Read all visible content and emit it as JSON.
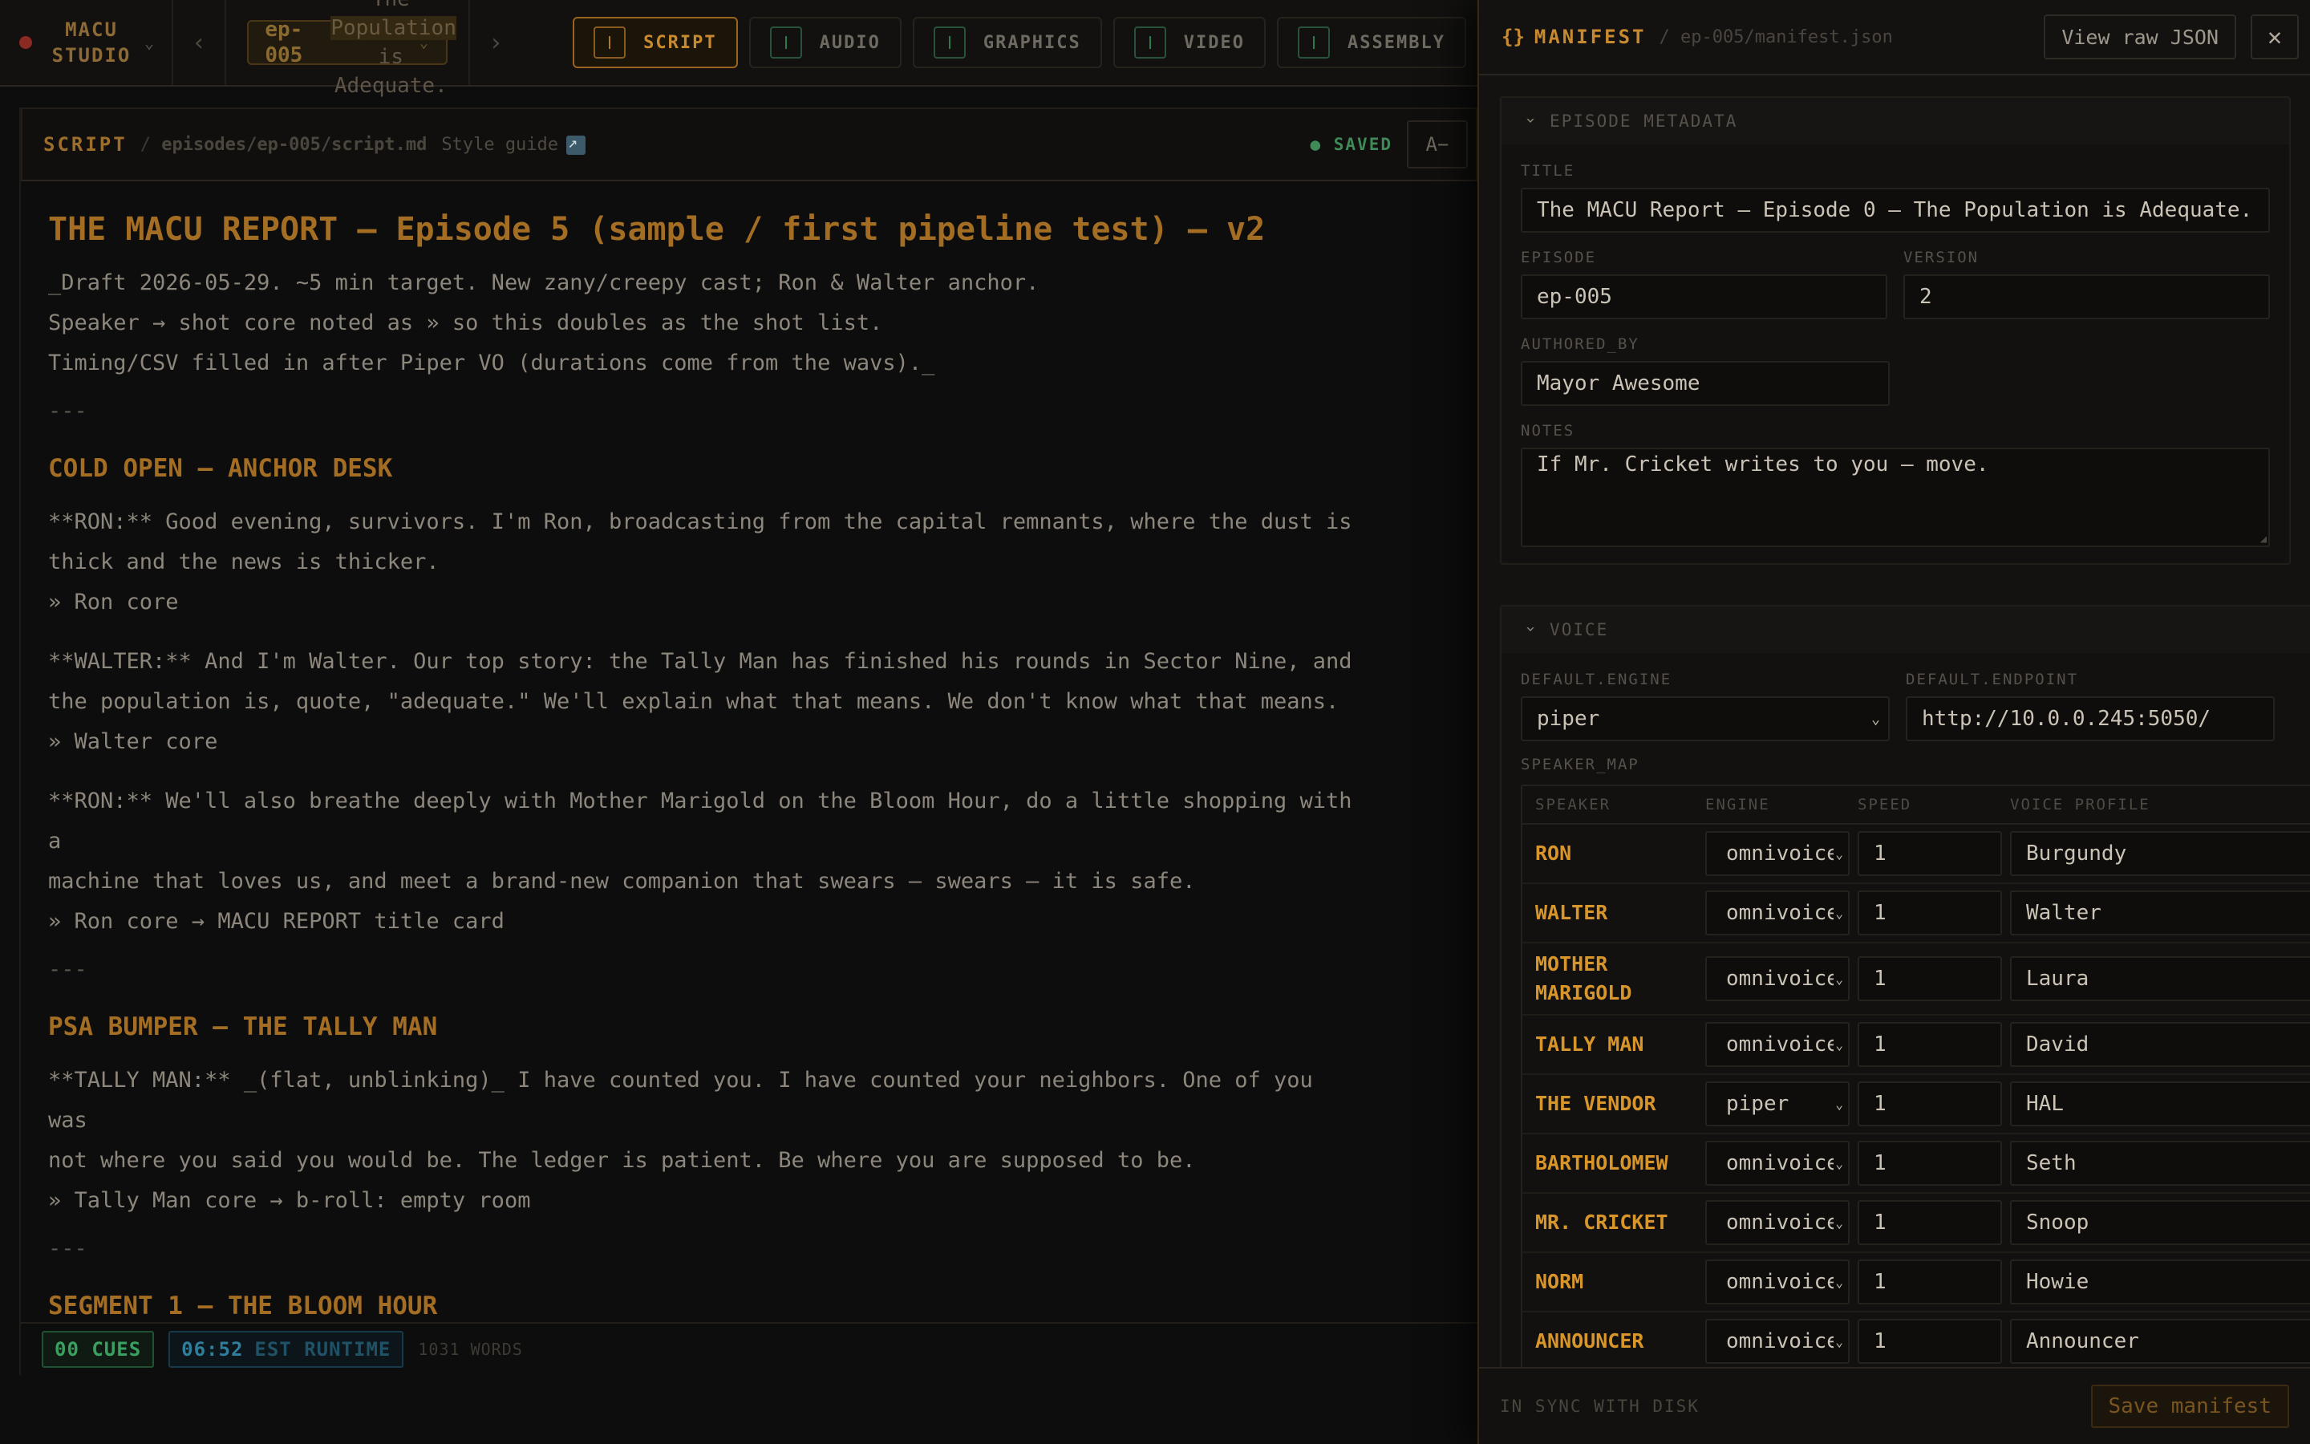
{
  "brand": {
    "name": "MACU STUDIO"
  },
  "episode_selector": {
    "code": "ep-005",
    "title_pre": "The",
    "title_hl": "Population",
    "title_post1": "is",
    "title_post2": "Adequate."
  },
  "tabs": [
    {
      "label": "SCRIPT",
      "active": true
    },
    {
      "label": "AUDIO"
    },
    {
      "label": "GRAPHICS"
    },
    {
      "label": "VIDEO"
    },
    {
      "label": "ASSEMBLY"
    }
  ],
  "script": {
    "label": "SCRIPT",
    "path": "episodes/ep-005/script.md",
    "style_guide": "Style guide",
    "saved": "● SAVED",
    "font_button": "A−",
    "heading": "THE MACU REPORT — Episode 5 (sample / first pipeline test) — v2",
    "intro": [
      "_Draft 2026-05-29. ~5 min target. New zany/creepy cast; Ron & Walter anchor.",
      "Speaker → shot core noted as » so this doubles as the shot list.",
      "Timing/CSV filled in after Piper VO (durations come from the wavs)._"
    ],
    "rule": "---",
    "cold_open": {
      "heading": "COLD OPEN — ANCHOR DESK",
      "blocks": [
        {
          "lines": [
            "**RON:** Good evening, survivors. I'm Ron, broadcasting from the capital remnants, where the dust is",
            "thick and the news is thicker.",
            "» Ron core"
          ]
        },
        {
          "lines": [
            "**WALTER:** And I'm Walter. Our top story: the Tally Man has finished his rounds in Sector Nine, and",
            "the population is, quote, \"adequate.\" We'll explain what that means. We don't know what that means.",
            "» Walter core"
          ]
        },
        {
          "lines": [
            "**RON:** We'll also breathe deeply with Mother Marigold on the Bloom Hour, do a little shopping with a",
            "machine that loves us, and meet a brand-new companion that swears — swears — it is safe.",
            "» Ron core → MACU REPORT title card"
          ]
        }
      ]
    },
    "psa": {
      "heading": "PSA BUMPER — THE TALLY MAN",
      "lines": [
        "**TALLY MAN:** _(flat, unblinking)_ I have counted you. I have counted your neighbors. One of you was",
        "not where you said you would be. The ledger is patient. Be where you are supposed to be.",
        "» Tally Man core → b-roll: empty room"
      ]
    },
    "segment1": {
      "heading": "SEGMENT 1 — THE BLOOM HOUR"
    },
    "footer": {
      "cues": "00 CUES",
      "runtime": "06:52",
      "runtime_label": "EST RUNTIME",
      "words": "1031 WORDS"
    }
  },
  "manifest": {
    "label": "MANIFEST",
    "braces": "{}",
    "path": "/ ep-005/manifest.json",
    "view_raw": "View raw JSON",
    "close": "✕",
    "metadata": {
      "section_label": "EPISODE METADATA",
      "title_label": "TITLE",
      "title": "The MACU Report — Episode 0 — The Population is Adequate.",
      "episode_label": "EPISODE",
      "episode": "ep-005",
      "version_label": "VERSION",
      "version": "2",
      "authored_by_label": "AUTHORED_BY",
      "authored_by": "Mayor Awesome",
      "notes_label": "NOTES",
      "notes": "If Mr. Cricket writes to you — move."
    },
    "voice": {
      "section_label": "VOICE",
      "engine_label": "DEFAULT.ENGINE",
      "engine": "piper",
      "endpoint_label": "DEFAULT.ENDPOINT",
      "endpoint": "http://10.0.0.245:5050/",
      "speaker_map_label": "SPEAKER_MAP",
      "columns": [
        "SPEAKER",
        "ENGINE",
        "SPEED",
        "VOICE PROFILE"
      ],
      "speakers": [
        {
          "speaker": "RON",
          "engine": "omnivoice",
          "speed": "1",
          "profile": "Burgundy"
        },
        {
          "speaker": "WALTER",
          "engine": "omnivoice",
          "speed": "1",
          "profile": "Walter"
        },
        {
          "speaker": "MOTHER MARIGOLD",
          "engine": "omnivoice",
          "speed": "1",
          "profile": "Laura"
        },
        {
          "speaker": "TALLY MAN",
          "engine": "omnivoice",
          "speed": "1",
          "profile": "David"
        },
        {
          "speaker": "THE VENDOR",
          "engine": "piper",
          "speed": "1",
          "profile": "HAL"
        },
        {
          "speaker": "BARTHOLOMEW",
          "engine": "omnivoice",
          "speed": "1",
          "profile": "Seth"
        },
        {
          "speaker": "MR. CRICKET",
          "engine": "omnivoice",
          "speed": "1",
          "profile": "Snoop"
        },
        {
          "speaker": "NORM",
          "engine": "omnivoice",
          "speed": "1",
          "profile": "Howie"
        },
        {
          "speaker": "ANNOUNCER",
          "engine": "omnivoice",
          "speed": "1",
          "profile": "Announcer"
        }
      ]
    },
    "footer": {
      "sync": "IN SYNC WITH DISK",
      "save": "Save manifest"
    }
  }
}
